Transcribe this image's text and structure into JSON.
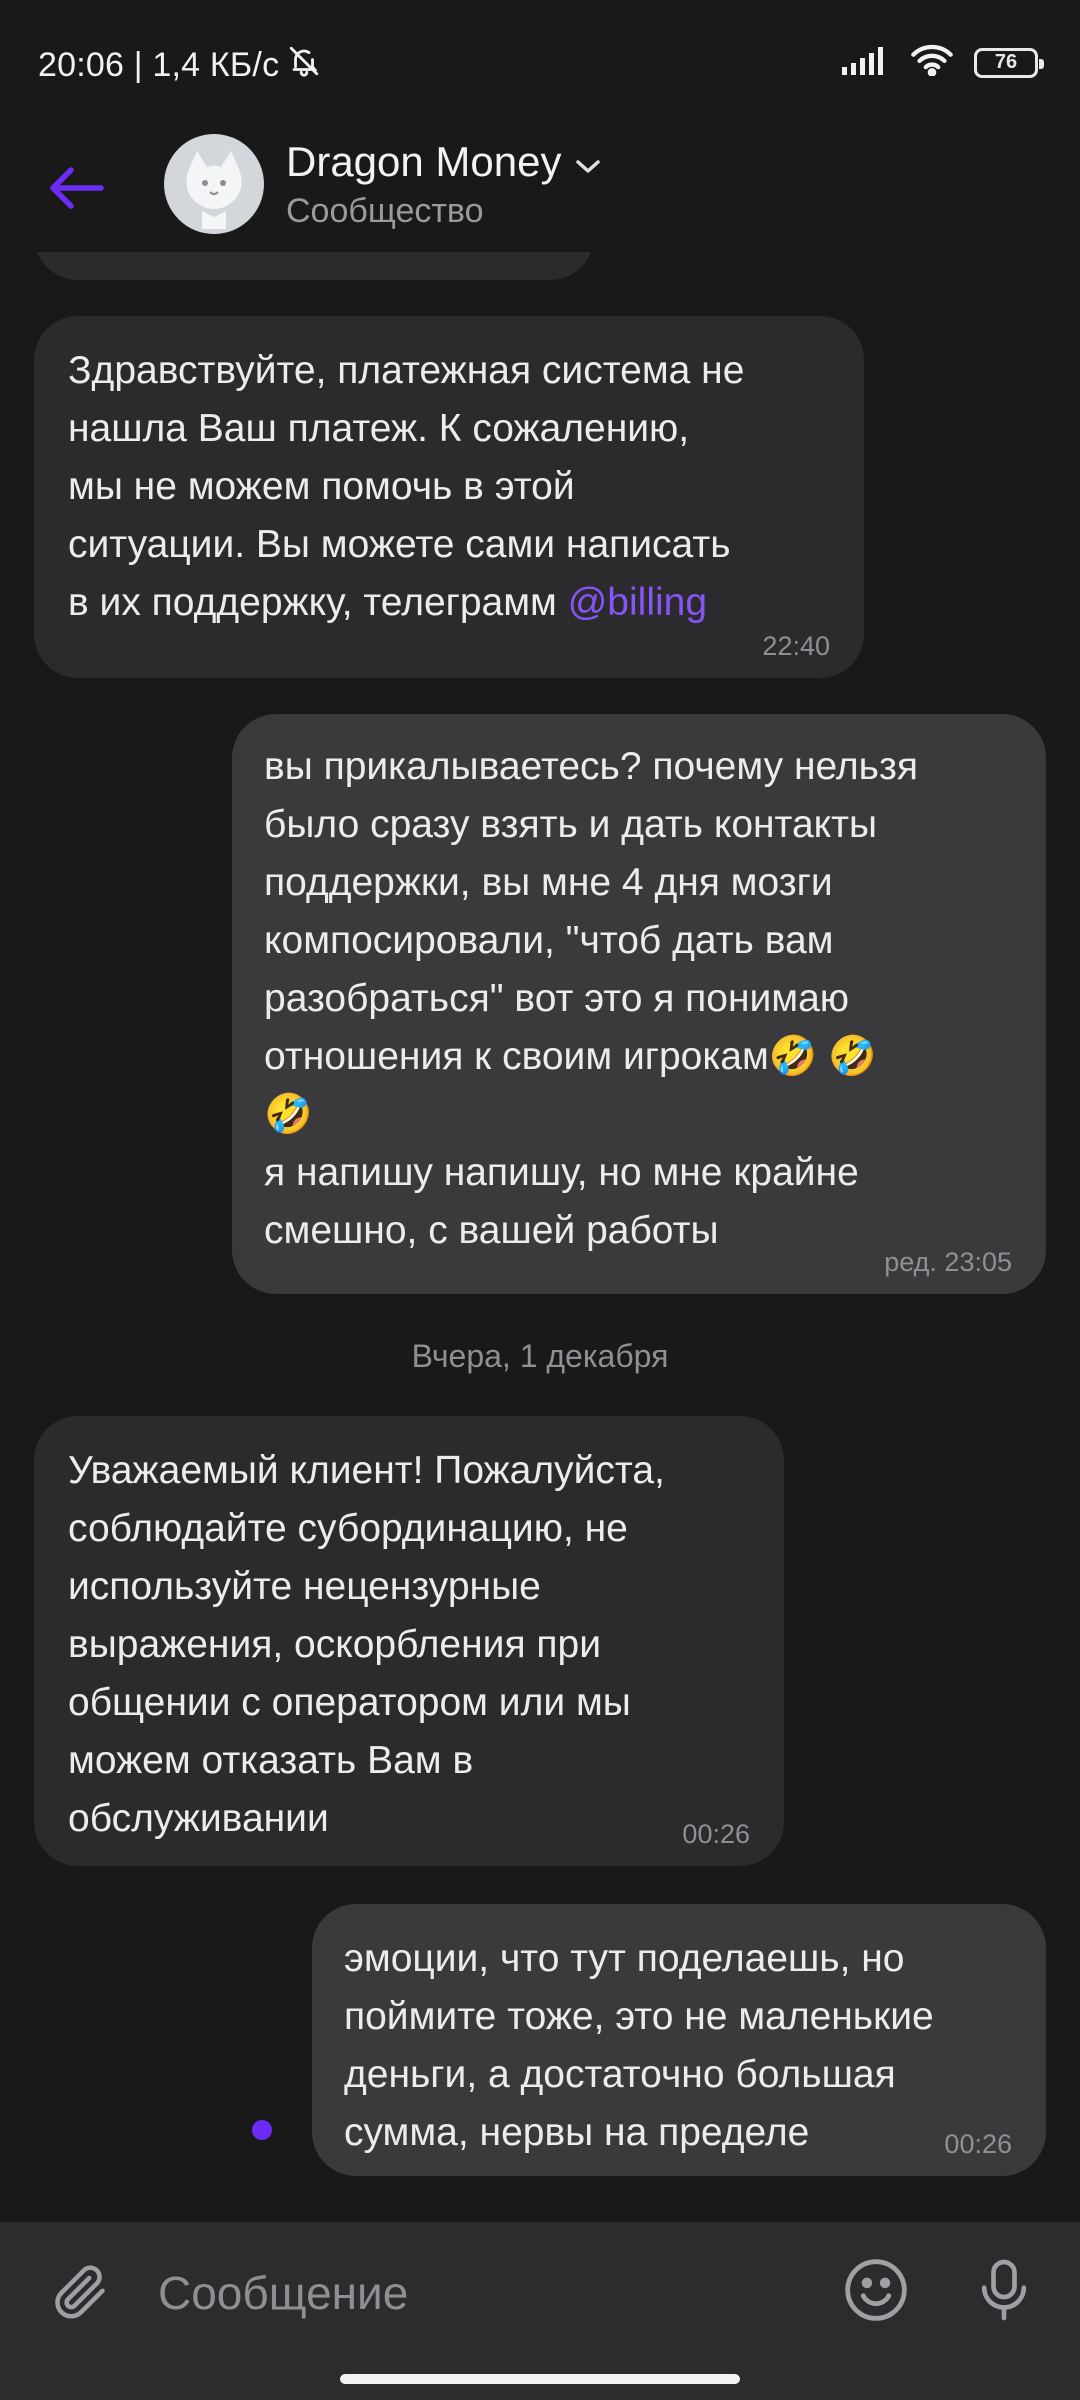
{
  "status_bar": {
    "time_speed": "20:06 | 1,4 КБ/с",
    "battery": "76"
  },
  "header": {
    "title": "Dragon Money",
    "subtitle": "Сообщество"
  },
  "messages": [
    {
      "direction": "in",
      "text": "Здравствуйте, платежная система не\nнашла Ваш платеж. К сожалению,\nмы не можем помочь в этой\nситуации. Вы можете сами написать\nв их поддержку, телеграмм ",
      "mention": "@billing",
      "time": "22:40"
    },
    {
      "direction": "out",
      "text": "вы прикалываетесь? почему нельзя\nбыло сразу взять и дать контакты\nподдержки, вы мне 4 дня мозги\nкомпосировали, \"чтоб дать вам\nразобраться\" вот это я понимаю\nотношения к своим игрокам🤣 🤣\n🤣\nя напишу напишу, но мне крайне\nсмешно, с вашей работы",
      "time": "ред. 23:05"
    },
    {
      "direction": "in",
      "text": "Уважаемый клиент! Пожалуйста,\nсоблюдайте субординацию, не\nиспользуйте нецензурные\nвыражения, оскорбления при\nобщении с оператором или мы\nможем отказать Вам в\nобслуживании",
      "time": "00:26"
    },
    {
      "direction": "out",
      "text": "эмоции, что тут поделаешь, но\nпоймите тоже, это не маленькие\nденьги, а достаточно большая\nсумма, нервы на пределе",
      "time": "00:26"
    }
  ],
  "date_separator": "Вчера, 1 декабря",
  "composer": {
    "placeholder": "Сообщение"
  },
  "icons": {
    "back": "arrow-left-icon",
    "chevron": "chevron-down-icon",
    "attach": "paperclip-icon",
    "emoji": "smiley-icon",
    "mic": "microphone-icon",
    "mute": "bell-off-icon",
    "signal": "signal-icon",
    "wifi": "wifi-icon"
  },
  "colors": {
    "accent": "#6d2cf5",
    "mention": "#8755f5",
    "incoming_bubble": "#2b2b2d",
    "outgoing_bubble": "#3a3a3d"
  }
}
